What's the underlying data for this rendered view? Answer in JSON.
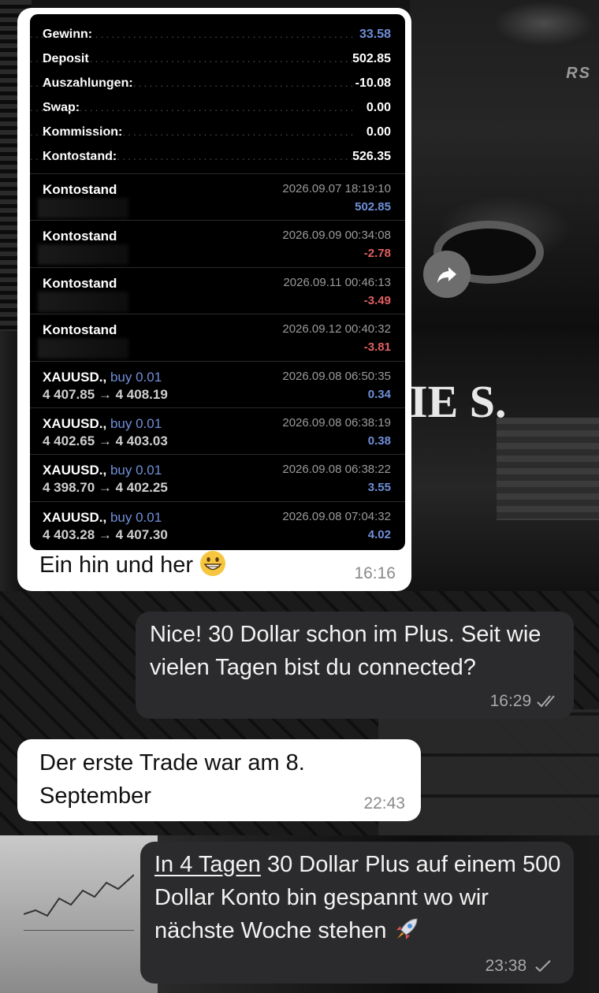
{
  "summary": [
    {
      "label": "Gewinn:",
      "value": "33.58",
      "accent": true
    },
    {
      "label": "Deposit",
      "value": "502.85",
      "accent": false
    },
    {
      "label": "Auszahlungen:",
      "value": "-10.08",
      "accent": false
    },
    {
      "label": "Swap:",
      "value": "0.00",
      "accent": false
    },
    {
      "label": "Kommission:",
      "value": "0.00",
      "accent": false
    },
    {
      "label": "Kontostand:",
      "value": "526.35",
      "accent": false
    }
  ],
  "transactions": [
    {
      "title": "Kontostand",
      "buy": "",
      "line2": "",
      "date": "2026.09.07 18:19:10",
      "amount": "502.85",
      "sign": "pos"
    },
    {
      "title": "Kontostand",
      "buy": "",
      "line2": "",
      "date": "2026.09.09 00:34:08",
      "amount": "-2.78",
      "sign": "neg"
    },
    {
      "title": "Kontostand",
      "buy": "",
      "line2": "",
      "date": "2026.09.11 00:46:13",
      "amount": "-3.49",
      "sign": "neg"
    },
    {
      "title": "Kontostand",
      "buy": "",
      "line2": "",
      "date": "2026.09.12 00:40:32",
      "amount": "-3.81",
      "sign": "neg"
    },
    {
      "title": "XAUUSD.,",
      "buy": "buy 0.01",
      "line2": "4 407.85 → 4 408.19",
      "date": "2026.09.08 06:50:35",
      "amount": "0.34",
      "sign": "pos"
    },
    {
      "title": "XAUUSD.,",
      "buy": "buy 0.01",
      "line2": "4 402.65 → 4 403.03",
      "date": "2026.09.08 06:38:19",
      "amount": "0.38",
      "sign": "pos"
    },
    {
      "title": "XAUUSD.,",
      "buy": "buy 0.01",
      "line2": "4 398.70 → 4 402.25",
      "date": "2026.09.08 06:38:22",
      "amount": "3.55",
      "sign": "pos"
    },
    {
      "title": "XAUUSD.,",
      "buy": "buy 0.01",
      "line2": "4 403.28 → 4 407.30",
      "date": "2026.09.08 07:04:32",
      "amount": "4.02",
      "sign": "pos"
    }
  ],
  "messages": {
    "m1": {
      "text": "Ein hin und her",
      "emoji": "grinning-face-icon",
      "time": "16:16"
    },
    "m2": {
      "text": "Nice! 30 Dollar schon im Plus. Seit wie vielen Tagen bist du connected?",
      "time": "16:29",
      "status": "read-double-check-icon"
    },
    "m3": {
      "text": "Der erste Trade war am 8. September",
      "time": "22:43"
    },
    "m4": {
      "underlined": "In 4 Tagen",
      "text": " 30 Dollar Plus auf einem 500 Dollar Konto bin gespannt wo wir nächste Woche stehen",
      "emoji": "rocket-icon",
      "time": "23:38",
      "status": "sent-check-icon"
    }
  },
  "background": {
    "car_badge": "RS",
    "garage_text": "IE S."
  },
  "colors": {
    "accent_blue": "#6f8fd9",
    "negative_red": "#e06060",
    "incoming_bubble": "#ffffff",
    "outgoing_bubble": "#2b2b2d"
  }
}
